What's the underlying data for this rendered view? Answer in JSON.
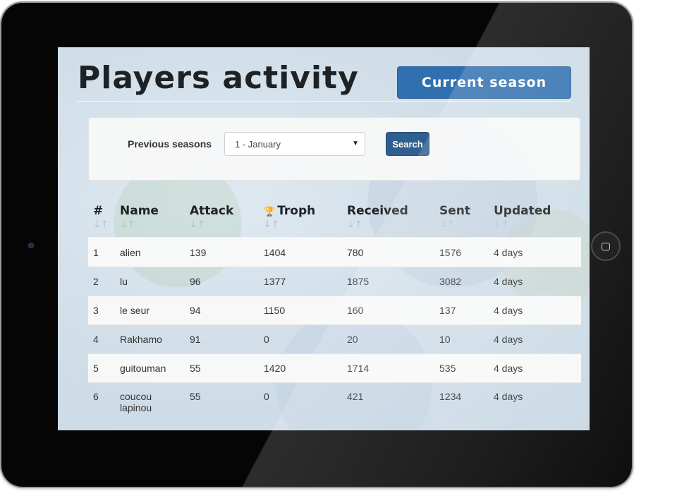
{
  "page": {
    "title": "Players activity",
    "current_season_label": "Current season"
  },
  "filter": {
    "label": "Previous seasons",
    "selected_option": "1 - January",
    "search_label": "Search"
  },
  "table": {
    "columns": [
      {
        "label": "#",
        "icon": ""
      },
      {
        "label": "Name",
        "icon": ""
      },
      {
        "label": "Attack",
        "icon": ""
      },
      {
        "label": "Troph",
        "icon": "trophy-icon"
      },
      {
        "label": "Received",
        "icon": ""
      },
      {
        "label": "Sent",
        "icon": ""
      },
      {
        "label": "Updated",
        "icon": ""
      }
    ],
    "sort_glyph": "↓↑",
    "trophy_glyph": "🏆",
    "rows": [
      {
        "rank": "1",
        "name": "alien",
        "attack": "139",
        "troph": "1404",
        "received": "780",
        "sent": "1576",
        "updated": "4 days"
      },
      {
        "rank": "2",
        "name": "lu",
        "attack": "96",
        "troph": "1377",
        "received": "1875",
        "sent": "3082",
        "updated": "4 days"
      },
      {
        "rank": "3",
        "name": "le seur",
        "attack": "94",
        "troph": "1150",
        "received": "160",
        "sent": "137",
        "updated": "4 days"
      },
      {
        "rank": "4",
        "name": "Rakhamo",
        "attack": "91",
        "troph": "0",
        "received": "20",
        "sent": "10",
        "updated": "4 days"
      },
      {
        "rank": "5",
        "name": "guitouman",
        "attack": "55",
        "troph": "1420",
        "received": "1714",
        "sent": "535",
        "updated": "4 days"
      },
      {
        "rank": "6",
        "name": "coucou lapinou",
        "attack": "55",
        "troph": "0",
        "received": "421",
        "sent": "1234",
        "updated": "4 days"
      }
    ]
  },
  "colors": {
    "accent_button": "#3070b0",
    "search_button": "#2f5f8f",
    "title_text": "#1f2224"
  }
}
